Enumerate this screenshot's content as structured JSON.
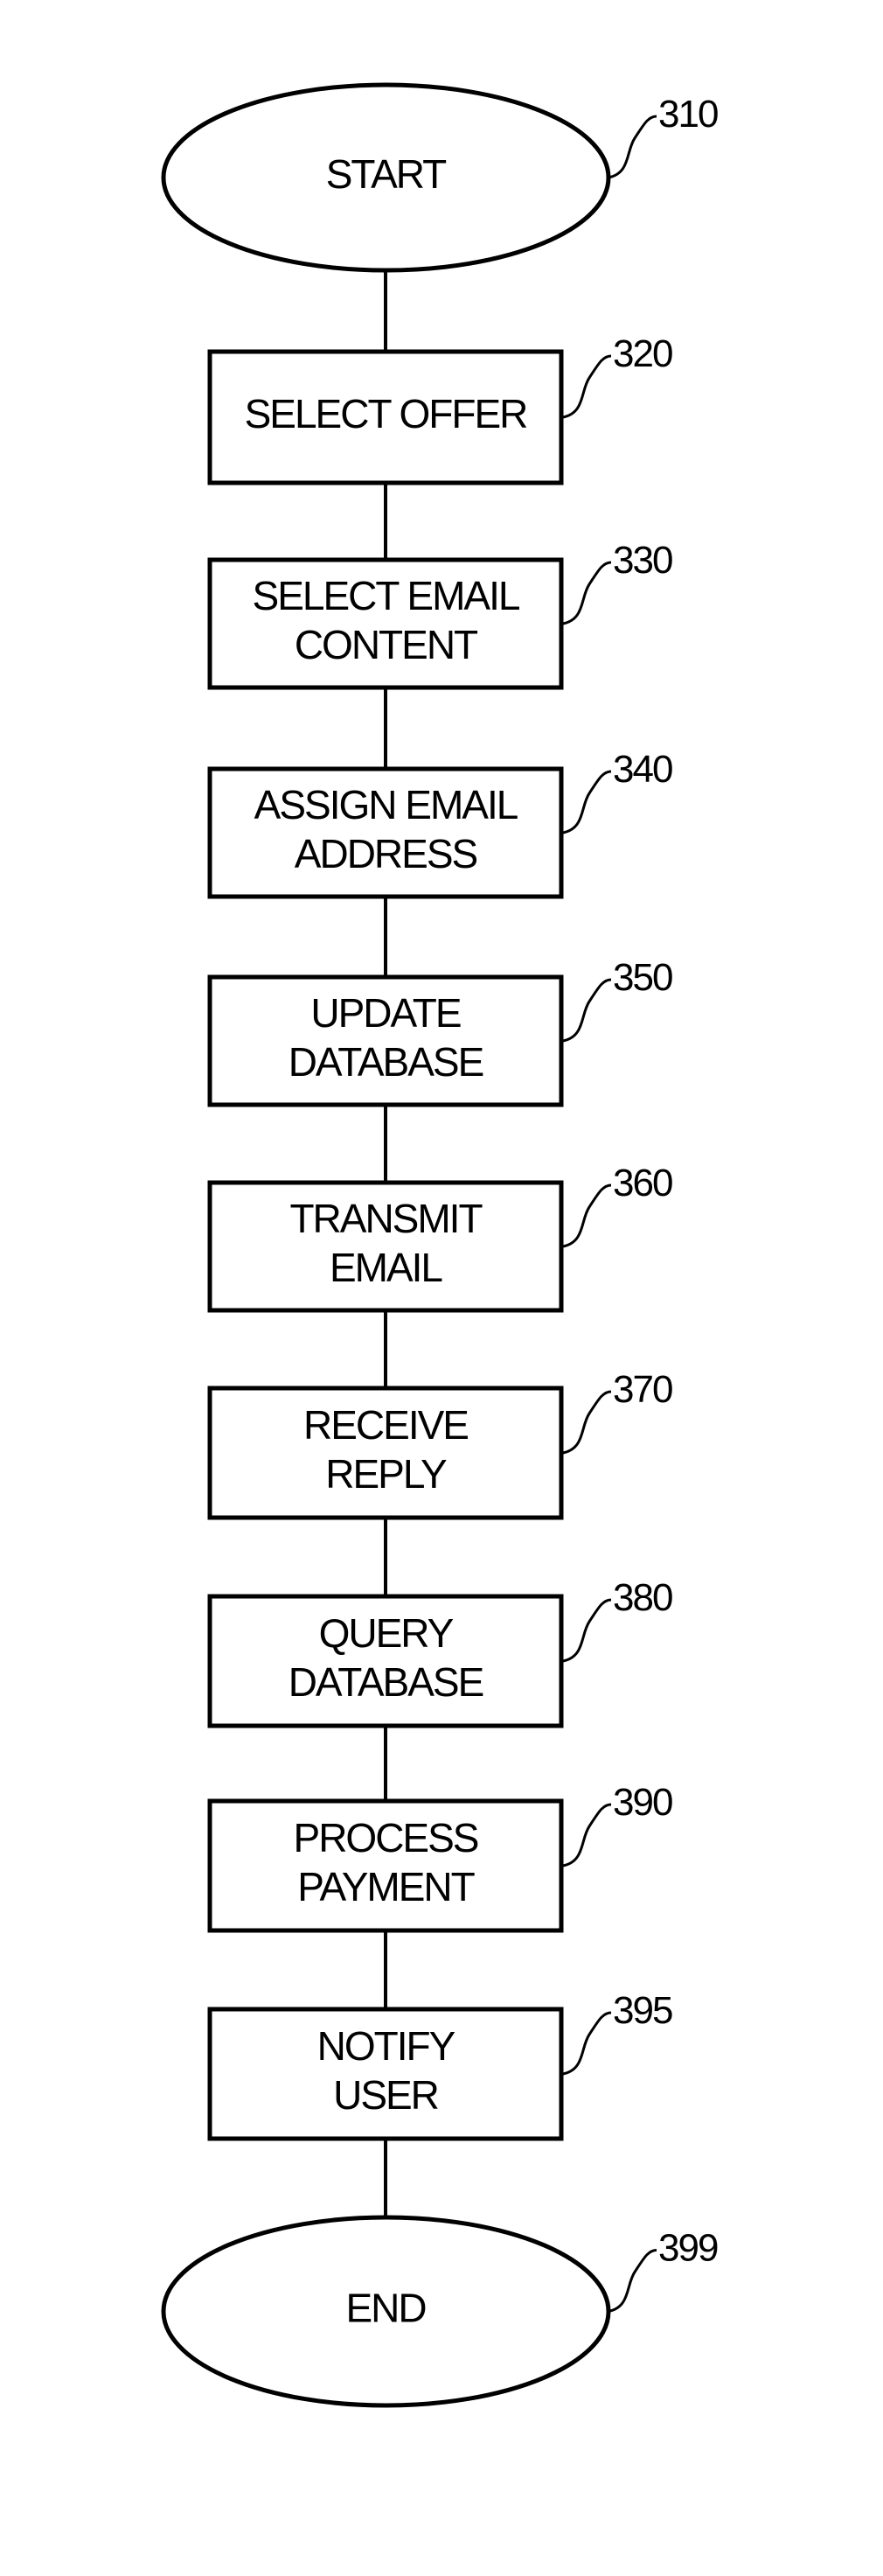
{
  "flowchart": {
    "nodes": [
      {
        "id": "310",
        "type": "terminal",
        "lines": [
          "START"
        ]
      },
      {
        "id": "320",
        "type": "process",
        "lines": [
          "SELECT OFFER"
        ]
      },
      {
        "id": "330",
        "type": "process",
        "lines": [
          "SELECT EMAIL",
          "CONTENT"
        ]
      },
      {
        "id": "340",
        "type": "process",
        "lines": [
          "ASSIGN EMAIL",
          "ADDRESS"
        ]
      },
      {
        "id": "350",
        "type": "process",
        "lines": [
          "UPDATE",
          "DATABASE"
        ]
      },
      {
        "id": "360",
        "type": "process",
        "lines": [
          "TRANSMIT",
          "EMAIL"
        ]
      },
      {
        "id": "370",
        "type": "process",
        "lines": [
          "RECEIVE",
          "REPLY"
        ]
      },
      {
        "id": "380",
        "type": "process",
        "lines": [
          "QUERY",
          "DATABASE"
        ]
      },
      {
        "id": "390",
        "type": "process",
        "lines": [
          "PROCESS",
          "PAYMENT"
        ]
      },
      {
        "id": "395",
        "type": "process",
        "lines": [
          "NOTIFY",
          "USER"
        ]
      },
      {
        "id": "399",
        "type": "terminal",
        "lines": [
          "END"
        ]
      }
    ]
  }
}
